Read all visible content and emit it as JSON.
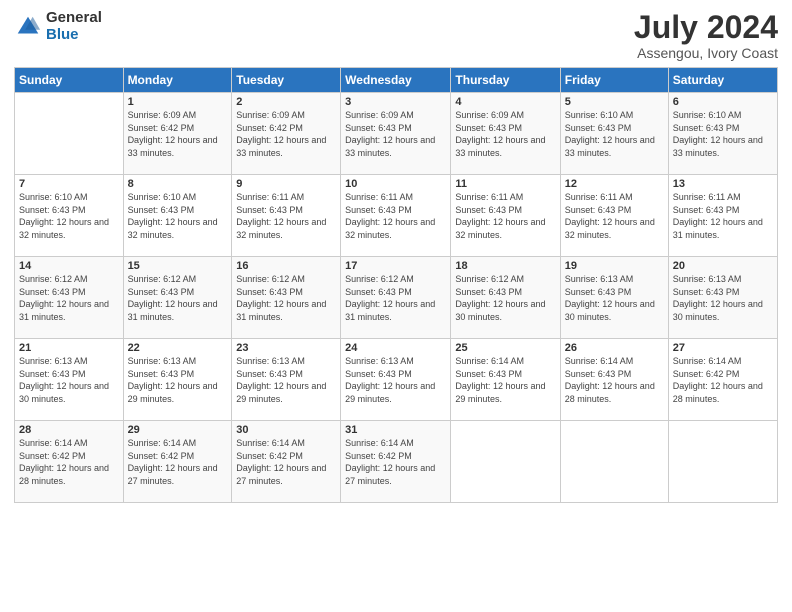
{
  "logo": {
    "general": "General",
    "blue": "Blue"
  },
  "title": "July 2024",
  "location": "Assengou, Ivory Coast",
  "days_header": [
    "Sunday",
    "Monday",
    "Tuesday",
    "Wednesday",
    "Thursday",
    "Friday",
    "Saturday"
  ],
  "weeks": [
    [
      {
        "num": "",
        "sunrise": "",
        "sunset": "",
        "daylight": ""
      },
      {
        "num": "1",
        "sunrise": "Sunrise: 6:09 AM",
        "sunset": "Sunset: 6:42 PM",
        "daylight": "Daylight: 12 hours and 33 minutes."
      },
      {
        "num": "2",
        "sunrise": "Sunrise: 6:09 AM",
        "sunset": "Sunset: 6:42 PM",
        "daylight": "Daylight: 12 hours and 33 minutes."
      },
      {
        "num": "3",
        "sunrise": "Sunrise: 6:09 AM",
        "sunset": "Sunset: 6:43 PM",
        "daylight": "Daylight: 12 hours and 33 minutes."
      },
      {
        "num": "4",
        "sunrise": "Sunrise: 6:09 AM",
        "sunset": "Sunset: 6:43 PM",
        "daylight": "Daylight: 12 hours and 33 minutes."
      },
      {
        "num": "5",
        "sunrise": "Sunrise: 6:10 AM",
        "sunset": "Sunset: 6:43 PM",
        "daylight": "Daylight: 12 hours and 33 minutes."
      },
      {
        "num": "6",
        "sunrise": "Sunrise: 6:10 AM",
        "sunset": "Sunset: 6:43 PM",
        "daylight": "Daylight: 12 hours and 33 minutes."
      }
    ],
    [
      {
        "num": "7",
        "sunrise": "Sunrise: 6:10 AM",
        "sunset": "Sunset: 6:43 PM",
        "daylight": "Daylight: 12 hours and 32 minutes."
      },
      {
        "num": "8",
        "sunrise": "Sunrise: 6:10 AM",
        "sunset": "Sunset: 6:43 PM",
        "daylight": "Daylight: 12 hours and 32 minutes."
      },
      {
        "num": "9",
        "sunrise": "Sunrise: 6:11 AM",
        "sunset": "Sunset: 6:43 PM",
        "daylight": "Daylight: 12 hours and 32 minutes."
      },
      {
        "num": "10",
        "sunrise": "Sunrise: 6:11 AM",
        "sunset": "Sunset: 6:43 PM",
        "daylight": "Daylight: 12 hours and 32 minutes."
      },
      {
        "num": "11",
        "sunrise": "Sunrise: 6:11 AM",
        "sunset": "Sunset: 6:43 PM",
        "daylight": "Daylight: 12 hours and 32 minutes."
      },
      {
        "num": "12",
        "sunrise": "Sunrise: 6:11 AM",
        "sunset": "Sunset: 6:43 PM",
        "daylight": "Daylight: 12 hours and 32 minutes."
      },
      {
        "num": "13",
        "sunrise": "Sunrise: 6:11 AM",
        "sunset": "Sunset: 6:43 PM",
        "daylight": "Daylight: 12 hours and 31 minutes."
      }
    ],
    [
      {
        "num": "14",
        "sunrise": "Sunrise: 6:12 AM",
        "sunset": "Sunset: 6:43 PM",
        "daylight": "Daylight: 12 hours and 31 minutes."
      },
      {
        "num": "15",
        "sunrise": "Sunrise: 6:12 AM",
        "sunset": "Sunset: 6:43 PM",
        "daylight": "Daylight: 12 hours and 31 minutes."
      },
      {
        "num": "16",
        "sunrise": "Sunrise: 6:12 AM",
        "sunset": "Sunset: 6:43 PM",
        "daylight": "Daylight: 12 hours and 31 minutes."
      },
      {
        "num": "17",
        "sunrise": "Sunrise: 6:12 AM",
        "sunset": "Sunset: 6:43 PM",
        "daylight": "Daylight: 12 hours and 31 minutes."
      },
      {
        "num": "18",
        "sunrise": "Sunrise: 6:12 AM",
        "sunset": "Sunset: 6:43 PM",
        "daylight": "Daylight: 12 hours and 30 minutes."
      },
      {
        "num": "19",
        "sunrise": "Sunrise: 6:13 AM",
        "sunset": "Sunset: 6:43 PM",
        "daylight": "Daylight: 12 hours and 30 minutes."
      },
      {
        "num": "20",
        "sunrise": "Sunrise: 6:13 AM",
        "sunset": "Sunset: 6:43 PM",
        "daylight": "Daylight: 12 hours and 30 minutes."
      }
    ],
    [
      {
        "num": "21",
        "sunrise": "Sunrise: 6:13 AM",
        "sunset": "Sunset: 6:43 PM",
        "daylight": "Daylight: 12 hours and 30 minutes."
      },
      {
        "num": "22",
        "sunrise": "Sunrise: 6:13 AM",
        "sunset": "Sunset: 6:43 PM",
        "daylight": "Daylight: 12 hours and 29 minutes."
      },
      {
        "num": "23",
        "sunrise": "Sunrise: 6:13 AM",
        "sunset": "Sunset: 6:43 PM",
        "daylight": "Daylight: 12 hours and 29 minutes."
      },
      {
        "num": "24",
        "sunrise": "Sunrise: 6:13 AM",
        "sunset": "Sunset: 6:43 PM",
        "daylight": "Daylight: 12 hours and 29 minutes."
      },
      {
        "num": "25",
        "sunrise": "Sunrise: 6:14 AM",
        "sunset": "Sunset: 6:43 PM",
        "daylight": "Daylight: 12 hours and 29 minutes."
      },
      {
        "num": "26",
        "sunrise": "Sunrise: 6:14 AM",
        "sunset": "Sunset: 6:43 PM",
        "daylight": "Daylight: 12 hours and 28 minutes."
      },
      {
        "num": "27",
        "sunrise": "Sunrise: 6:14 AM",
        "sunset": "Sunset: 6:42 PM",
        "daylight": "Daylight: 12 hours and 28 minutes."
      }
    ],
    [
      {
        "num": "28",
        "sunrise": "Sunrise: 6:14 AM",
        "sunset": "Sunset: 6:42 PM",
        "daylight": "Daylight: 12 hours and 28 minutes."
      },
      {
        "num": "29",
        "sunrise": "Sunrise: 6:14 AM",
        "sunset": "Sunset: 6:42 PM",
        "daylight": "Daylight: 12 hours and 27 minutes."
      },
      {
        "num": "30",
        "sunrise": "Sunrise: 6:14 AM",
        "sunset": "Sunset: 6:42 PM",
        "daylight": "Daylight: 12 hours and 27 minutes."
      },
      {
        "num": "31",
        "sunrise": "Sunrise: 6:14 AM",
        "sunset": "Sunset: 6:42 PM",
        "daylight": "Daylight: 12 hours and 27 minutes."
      },
      {
        "num": "",
        "sunrise": "",
        "sunset": "",
        "daylight": ""
      },
      {
        "num": "",
        "sunrise": "",
        "sunset": "",
        "daylight": ""
      },
      {
        "num": "",
        "sunrise": "",
        "sunset": "",
        "daylight": ""
      }
    ]
  ]
}
